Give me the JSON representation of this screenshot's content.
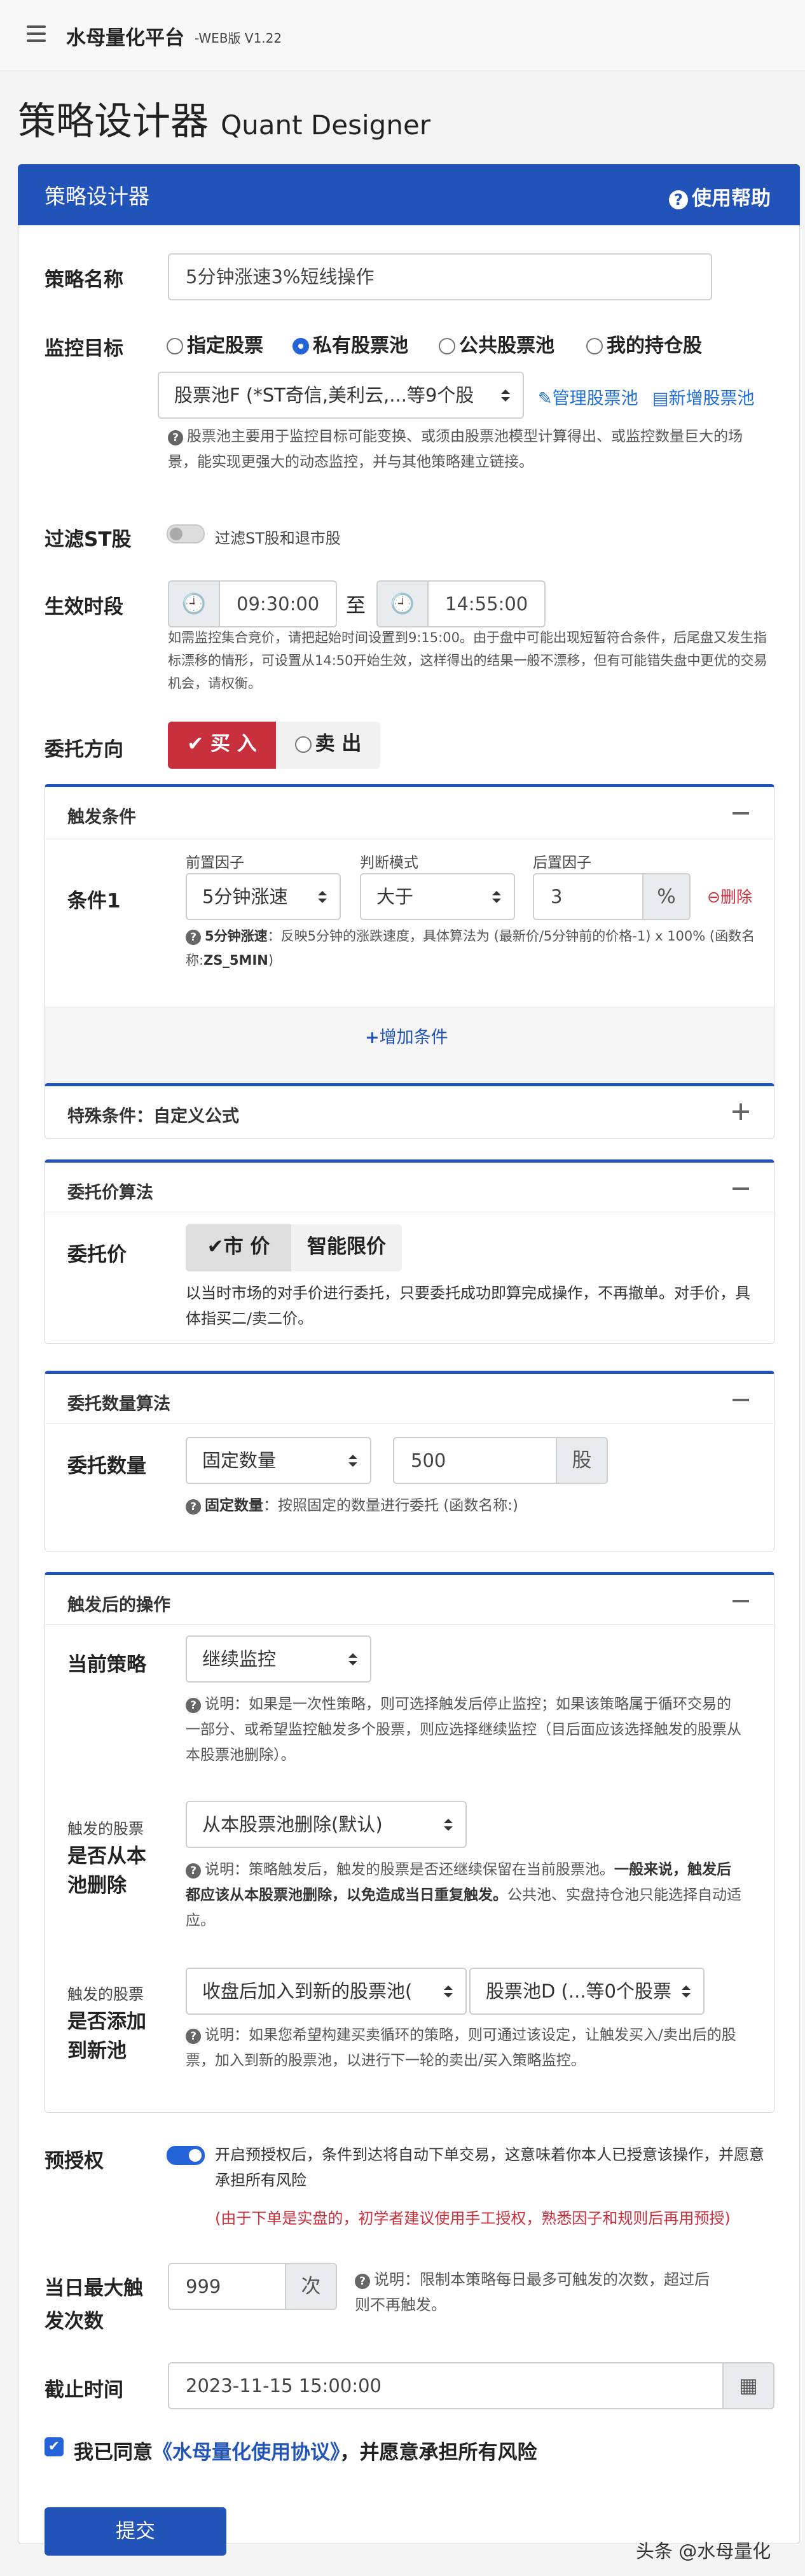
{
  "nav": {
    "app_name": "水母量化平台",
    "version": "-WEB版 V1.22"
  },
  "page": {
    "title_cn": "策略设计器",
    "title_en": "Quant Designer"
  },
  "card": {
    "title": "策略设计器",
    "help_label": "使用帮助"
  },
  "strategy_name": {
    "label": "策略名称",
    "value": "5分钟涨速3%短线操作"
  },
  "monitor": {
    "label": "监控目标",
    "options": [
      "指定股票",
      "私有股票池",
      "公共股票池",
      "我的持仓股"
    ],
    "selected": "私有股票池",
    "pool_select": "股票池F (*ST奇信,美利云,...等9个股",
    "manage_link": "管理股票池",
    "new_link": "新增股票池",
    "hint": "股票池主要用于监控目标可能变换、或须由股票池模型计算得出、或监控数量巨大的场景，能实现更强大的动态监控，并与其他策略建立链接。"
  },
  "filter_st": {
    "label": "过滤ST股",
    "toggle_text": "过滤ST股和退市股",
    "enabled": false
  },
  "active_period": {
    "label": "生效时段",
    "start": "09:30:00",
    "sep": "至",
    "end": "14:55:00",
    "hint": "如需监控集合竞价，请把起始时间设置到9:15:00。由于盘中可能出现短暂符合条件，后尾盘又发生指标漂移的情形，可设置从14:50开始生效，这样得出的结果一般不漂移，但有可能错失盘中更优的交易机会，请权衡。"
  },
  "direction": {
    "label": "委托方向",
    "buy": "买 入",
    "sell": "卖 出",
    "selected": "买 入"
  },
  "trigger": {
    "title": "触发条件",
    "cond_label": "条件1",
    "col_pre": "前置因子",
    "col_mode": "判断模式",
    "col_post": "后置因子",
    "pre_value": "5分钟涨速",
    "mode_value": "大于",
    "post_value": "3",
    "unit": "%",
    "delete": "删除",
    "hint_name": "5分钟涨速",
    "hint_text": "：反映5分钟的涨跌速度，具体算法为 (最新价/5分钟前的价格-1) x 100% (函数名称:",
    "hint_func": "ZS_5MIN",
    "hint_end": ")",
    "add": "增加条件"
  },
  "special": {
    "title": "特殊条件：自定义公式"
  },
  "price_algo": {
    "title": "委托价算法",
    "label": "委托价",
    "market": "市 价",
    "smart": "智能限价",
    "selected": "市 价",
    "desc": "以当时市场的对手价进行委托，只要委托成功即算完成操作，不再撤单。对手价，具体指买二/卖二价。"
  },
  "qty_algo": {
    "title": "委托数量算法",
    "label": "委托数量",
    "mode": "固定数量",
    "value": "500",
    "unit": "股",
    "hint_name": "固定数量",
    "hint_text": "：按照固定的数量进行委托 (函数名称:)"
  },
  "after": {
    "title": "触发后的操作",
    "current_label": "当前策略",
    "current_value": "继续监控",
    "current_hint": "说明：如果是一次性策略，则可选择触发后停止监控；如果该策略属于循环交易的一部分、或希望监控触发多个股票，则应选择继续监控（目后面应该选择触发的股票从本股票池删除）。",
    "remove_small": "触发的股票",
    "remove_label": "是否从本池删除",
    "remove_value": "从本股票池删除(默认)",
    "remove_hint_a": "说明：策略触发后，触发的股票是否还继续保留在当前股票池。",
    "remove_hint_b": "一般来说，触发后都应该从本股票池删除，以免造成当日重复触发。",
    "remove_hint_c": "公共池、实盘持仓池只能选择自动适应。",
    "add_small": "触发的股票",
    "add_label": "是否添加到新池",
    "add_value": "收盘后加入到新的股票池(",
    "add_pool": "股票池D (...等0个股票",
    "add_hint": "说明：如果您希望构建买卖循环的策略，则可通过该设定，让触发买入/卖出后的股票，加入到新的股票池，以进行下一轮的卖出/买入策略监控。"
  },
  "preauth": {
    "label": "预授权",
    "enabled": true,
    "text": "开启预授权后，条件到达将自动下单交易，这意味着你本人已授意该操作，并愿意承担所有风险",
    "warning": "(由于下单是实盘的，初学者建议使用手工授权，熟悉因子和规则后再用预授)"
  },
  "max_trigger": {
    "label": "当日最大触发次数",
    "value": "999",
    "unit": "次",
    "hint": "说明：限制本策略每日最多可触发的次数，超过后则不再触发。"
  },
  "deadline": {
    "label": "截止时间",
    "value": "2023-11-15 15:00:00"
  },
  "agreement": {
    "prefix": "我已同意",
    "link": "《水母量化使用协议》",
    "suffix": "，并愿意承担所有风险",
    "checked": true
  },
  "submit": {
    "label": "提交"
  },
  "watermark": "头条 @水母量化",
  "colors": {
    "primary": "#2153b8",
    "danger": "#c9303e",
    "link": "#1f6fd6"
  }
}
